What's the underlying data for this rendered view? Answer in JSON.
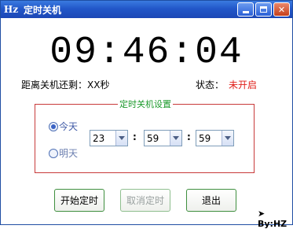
{
  "window": {
    "icon_text": "Hz",
    "title": "定时关机"
  },
  "clock": {
    "time": "09:46:04"
  },
  "info": {
    "countdown": "距离关机还剩：XX秒",
    "status_label": "状态：",
    "status_value": "未开启",
    "status_color": "#e0201a"
  },
  "schedule": {
    "group_title": "定时关机设置",
    "day_options": [
      {
        "label": "今天",
        "checked": true
      },
      {
        "label": "明天",
        "checked": false
      }
    ],
    "hour": "23",
    "minute": "59",
    "second": "59",
    "separator": ":"
  },
  "buttons": {
    "start": "开始定时",
    "cancel": "取消定时",
    "exit": "退出"
  },
  "footer": {
    "signature": "By:HZ"
  }
}
